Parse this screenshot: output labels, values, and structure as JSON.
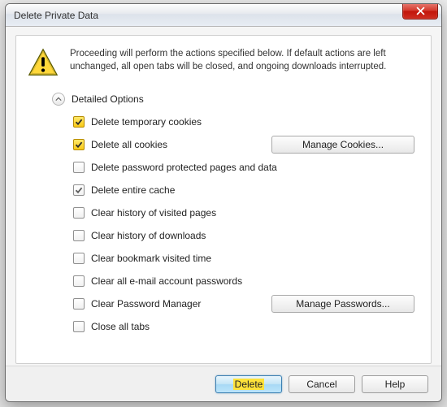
{
  "title": "Delete Private Data",
  "warning": "Proceeding will perform the actions specified below. If default actions are left unchanged, all open tabs will be closed, and ongoing downloads interrupted.",
  "section_label": "Detailed Options",
  "options": [
    {
      "label": "Delete temporary cookies",
      "checked": true,
      "style": "yellow",
      "side_button": null
    },
    {
      "label": "Delete all cookies",
      "checked": true,
      "style": "yellow",
      "side_button": "Manage Cookies..."
    },
    {
      "label": "Delete password protected pages and data",
      "checked": false,
      "style": "plain",
      "side_button": null
    },
    {
      "label": "Delete entire cache",
      "checked": true,
      "style": "gray",
      "side_button": null
    },
    {
      "label": "Clear history of visited pages",
      "checked": false,
      "style": "plain",
      "side_button": null
    },
    {
      "label": "Clear history of downloads",
      "checked": false,
      "style": "plain",
      "side_button": null
    },
    {
      "label": "Clear bookmark visited time",
      "checked": false,
      "style": "plain",
      "side_button": null
    },
    {
      "label": "Clear all e-mail account passwords",
      "checked": false,
      "style": "plain",
      "side_button": null
    },
    {
      "label": "Clear Password Manager",
      "checked": false,
      "style": "plain",
      "side_button": "Manage Passwords..."
    },
    {
      "label": "Close all tabs",
      "checked": false,
      "style": "plain",
      "side_button": null
    }
  ],
  "buttons": {
    "delete": "Delete",
    "cancel": "Cancel",
    "help": "Help"
  }
}
